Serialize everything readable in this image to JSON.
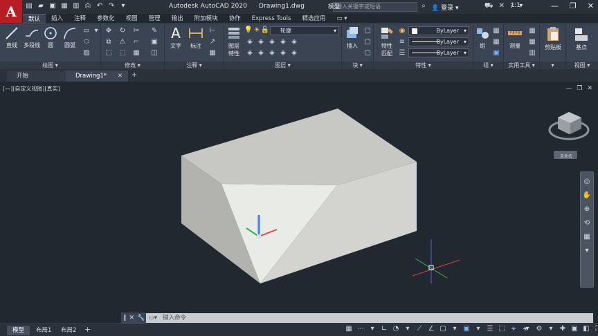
{
  "app": {
    "logo_letter": "A",
    "title": "Autodesk AutoCAD 2020",
    "document": "Drawing1.dwg",
    "search_placeholder": "键入关键字或短语",
    "login": "登录"
  },
  "menu_tabs": [
    "默认",
    "插入",
    "注释",
    "参数化",
    "视图",
    "管理",
    "输出",
    "附加模块",
    "协作",
    "Express Tools",
    "精选应用"
  ],
  "ribbon": {
    "draw": {
      "line": "直线",
      "polyline": "多段线",
      "circle": "圆",
      "arc": "圆弧",
      "title": "绘图 ▾"
    },
    "modify": {
      "title": "修改 ▾"
    },
    "annotation": {
      "text": "文字",
      "dimension": "标注",
      "title": "注释 ▾"
    },
    "layers": {
      "current": "轮廓",
      "properties": "图层\n特性",
      "title": "图层 ▾"
    },
    "block": {
      "insert": "插入",
      "title": "块 ▾"
    },
    "properties": {
      "match": "特性\n匹配",
      "color": "ByLayer",
      "linetype": "ByLayer",
      "lineweight": "ByLayer",
      "title": "特性 ▾"
    },
    "groups": {
      "group": "组",
      "title": "组 ▾"
    },
    "utilities": {
      "measure": "测量",
      "title": "实用工具 ▾"
    },
    "clipboard": {
      "paste": "剪贴板",
      "title": "▾"
    },
    "view": {
      "base": "基点",
      "title": "视图 ▾"
    }
  },
  "file_tabs": {
    "start": "开始",
    "drawing": "Drawing1*"
  },
  "viewport": {
    "label": "[—][自定义视图][真实]",
    "viewcube_label": "未命名"
  },
  "command": {
    "placeholder": "键入命令"
  },
  "layout_tabs": [
    "模型",
    "布局1",
    "布局2"
  ],
  "status": {
    "model": "模型",
    "scale": "1:1"
  },
  "colors": {
    "accent_blue": "#6fb3ff",
    "logo_red": "#b81d24",
    "background": "#212830"
  }
}
